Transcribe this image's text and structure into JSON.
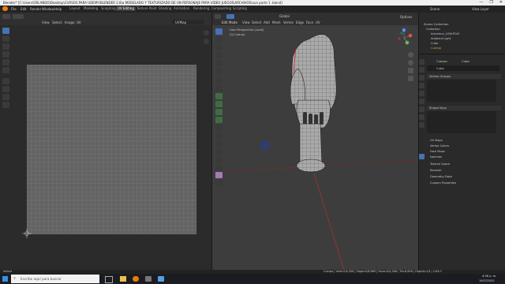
{
  "window": {
    "title": "Blender* [C:\\Users\\ORLANDO\\Desktop\\CURSOS PARA UDEMY\\BLENDER 2.8\\a MODELADO Y TEXTURIZADO DE UN PERSONAJE PARA VIDEO JUEGOS\\ARCHIVOS\\uva parte 1 .blend]",
    "controls": [
      "—",
      "❐",
      "✕"
    ]
  },
  "menu": {
    "items": [
      "File",
      "Edit",
      "Render",
      "Window",
      "Help"
    ],
    "workspaces": [
      "Layout",
      "Modeling",
      "Sculpting",
      "UV Editing",
      "Texture Paint",
      "Shading",
      "Animation",
      "Rendering",
      "Compositing",
      "Scripting"
    ],
    "active_workspace": "UV Editing",
    "scene": "Scene",
    "view_layer": "View Layer"
  },
  "uv_editor": {
    "header": [
      "View",
      "Select",
      "Image",
      "UV"
    ],
    "image_field": "UVMap"
  },
  "viewport": {
    "mode": "Edit Mode",
    "header": [
      "View",
      "Select",
      "Add",
      "Mesh",
      "Vertex",
      "Edge",
      "Face",
      "UV"
    ],
    "orientation": "Global",
    "overlay_title": "User Perspective (Local)",
    "overlay_object": "(0) Cuerpo",
    "options_label": "Options",
    "axis_labels": {
      "x": "X",
      "y": "Y",
      "z": "Z"
    }
  },
  "properties": {
    "outliner_title": "Scene Collection",
    "outliner_rows": [
      "Collection",
      "Armature_LOW.POLY",
      "Ambient Light",
      "Cubo",
      "Cuerpo"
    ],
    "tabs": [
      "Cuerpo",
      "Cube"
    ],
    "object_name": "Cube",
    "panels": {
      "vertex_groups": "Vertex Groups",
      "shape_keys": "Shape Keys"
    },
    "sections": [
      "UV Maps",
      "Vertex Colors",
      "Face Maps",
      "Normals",
      "Texture Space",
      "Remesh",
      "Geometry Data",
      "Custom Properties"
    ]
  },
  "status_bar": {
    "left": "Select",
    "right": "Cuerpo | Verts:0/4,356 | Edges:0/8,689 | Faces:0/4,348 | Tris:8,696 | Objects:1/3 | 2.83.0"
  },
  "taskbar": {
    "search_placeholder": "Escribe aquí para buscar",
    "clock_time": "4:56 p. m.",
    "clock_date": "19/07/2020"
  },
  "colors": {
    "accent": "#4772b3",
    "mesh_wire": "#c9c9c9",
    "seam": "#d83030",
    "cursor_ring": "#1a3bd6"
  }
}
